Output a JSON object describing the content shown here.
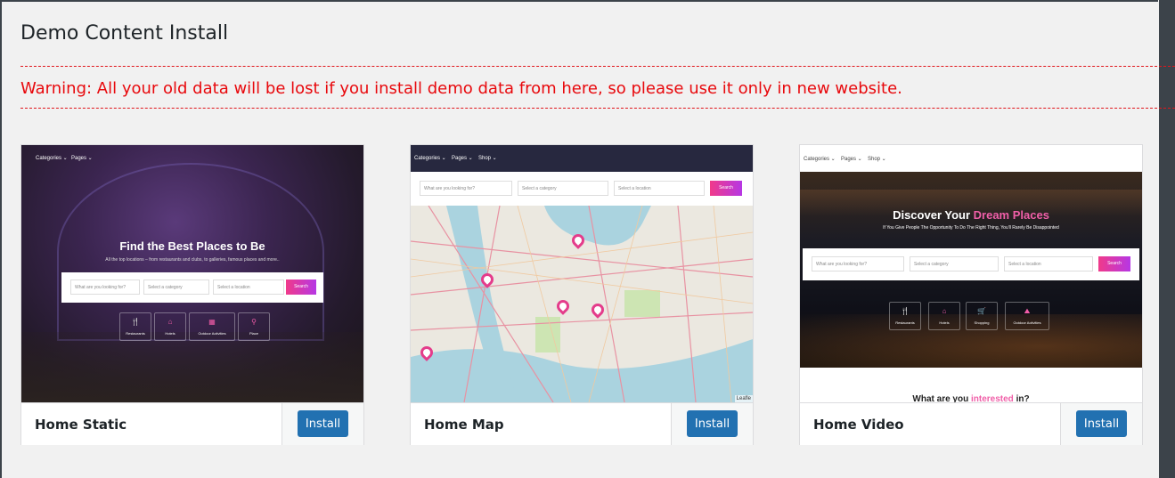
{
  "page": {
    "title": "Demo Content Install"
  },
  "warning": {
    "text": "Warning: All your old data will be lost if you install demo data from here, so please use it only in new website."
  },
  "colors": {
    "warning": "#e8090d",
    "primary_button": "#2271b1",
    "accent": "#e43c8b"
  },
  "themes": [
    {
      "name": "Home Static",
      "install_label": "Install",
      "preview": {
        "nav": [
          "Categories ⌄",
          "Pages ⌄"
        ],
        "hero_title": "Find the Best Places to Be",
        "hero_sub": "All the top locations – from restaurants and clubs, to galleries, famous places and more..",
        "search_what": "What are you looking for?",
        "search_category": "Select a category",
        "search_location": "Select a location",
        "search_button": "Search",
        "categories": [
          "Restaurants",
          "Hotels",
          "Outdoor Activities",
          "Place"
        ]
      }
    },
    {
      "name": "Home Map",
      "install_label": "Install",
      "preview": {
        "nav": [
          "Categories ⌄",
          "Pages ⌄",
          "Shop ⌄"
        ],
        "search_what": "What are you looking for?",
        "search_category": "Select a category",
        "search_location": "Select a location",
        "search_button": "Search",
        "map_credit": "Leafle"
      }
    },
    {
      "name": "Home Video",
      "install_label": "Install",
      "preview": {
        "nav": [
          "Categories ⌄",
          "Pages ⌄",
          "Shop ⌄"
        ],
        "hero_title_a": "Discover Your ",
        "hero_title_b": "Dream Places",
        "hero_sub": "If You Give People The Opportunity To Do The Right Thing, You'll Rarely Be Disappointed",
        "search_what": "What are you looking for?",
        "search_category": "Select a category",
        "search_location": "Select a location",
        "search_button": "Search",
        "categories": [
          "Restaurants",
          "Hotels",
          "Shopping",
          "Outdoor Activities"
        ],
        "footer_a": "What are you ",
        "footer_b": "interested",
        "footer_c": " in?"
      }
    }
  ]
}
